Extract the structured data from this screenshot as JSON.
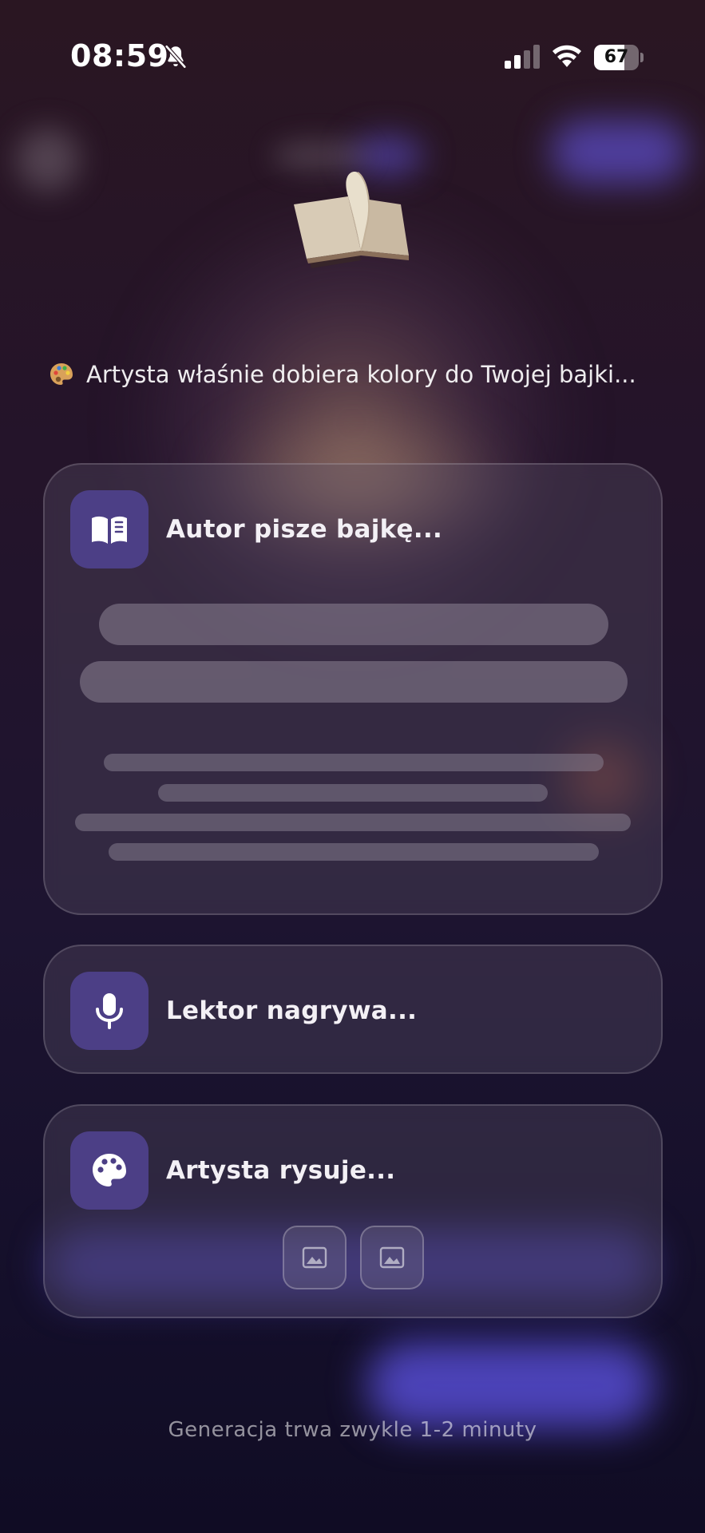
{
  "status_bar": {
    "time": "08:59",
    "battery_percent": 67,
    "battery_label": "67",
    "icons": [
      "bell-slash-icon",
      "cellular-signal-icon",
      "wifi-icon",
      "battery-icon"
    ]
  },
  "loading": {
    "icon": "open-book-icon",
    "status_emoji": "palette-emoji",
    "status_text": "Artysta właśnie dobiera kolory do Twojej bajki..."
  },
  "steps": [
    {
      "icon": "open-book-icon",
      "label": "Autor pisze bajkę..."
    },
    {
      "icon": "microphone-icon",
      "label": "Lektor nagrywa..."
    },
    {
      "icon": "palette-icon",
      "label": "Artysta rysuje..."
    }
  ],
  "image_placeholders": [
    "image-icon",
    "image-icon"
  ],
  "footer": {
    "note": "Generacja trwa zwykle 1-2 minuty"
  },
  "colors": {
    "accent": "#4c3f86",
    "background_top": "#2a1622",
    "background_bottom": "#100c24"
  }
}
